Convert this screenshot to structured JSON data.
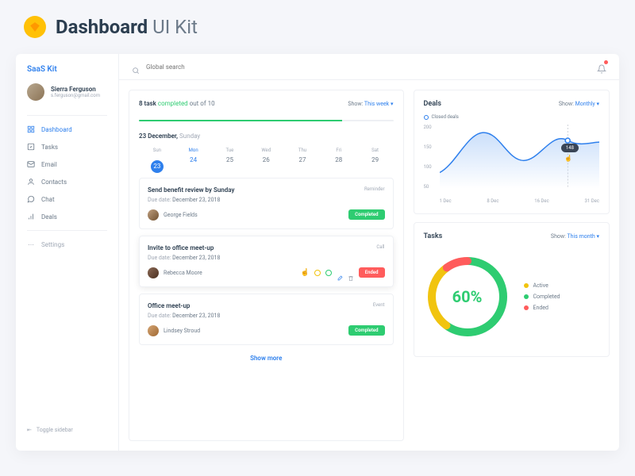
{
  "page": {
    "title_bold": "Dashboard",
    "title_light": " UI Kit"
  },
  "app": {
    "brand": "SaaS Kit",
    "user": {
      "name": "Sierra Ferguson",
      "email": "s.ferguson@gmail.com"
    },
    "nav": [
      {
        "label": "Dashboard",
        "icon": "grid-icon"
      },
      {
        "label": "Tasks",
        "icon": "checklist-icon"
      },
      {
        "label": "Email",
        "icon": "mail-icon"
      },
      {
        "label": "Contacts",
        "icon": "user-icon"
      },
      {
        "label": "Chat",
        "icon": "chat-icon"
      },
      {
        "label": "Deals",
        "icon": "bars-icon"
      }
    ],
    "settings_label": "Settings",
    "toggle_label": "Toggle sidebar",
    "search_placeholder": "Global search"
  },
  "tasks_card": {
    "summary": {
      "count": "8 task",
      "completed": "completed",
      "suffix": "out of 10"
    },
    "show_label": "Show:",
    "show_value": "This week",
    "date": {
      "bold": "23 December,",
      "day": "Sunday"
    },
    "week": [
      {
        "name": "Sun",
        "num": "23"
      },
      {
        "name": "Mon",
        "num": "24"
      },
      {
        "name": "Tue",
        "num": "25"
      },
      {
        "name": "Wed",
        "num": "26"
      },
      {
        "name": "Thu",
        "num": "27"
      },
      {
        "name": "Fri",
        "num": "28"
      },
      {
        "name": "Sat",
        "num": "29"
      }
    ],
    "items": [
      {
        "title": "Send benefit review by Sunday",
        "tag": "Reminder",
        "due_label": "Due date:",
        "due_value": "December 23, 2018",
        "assignee": "George Fields",
        "status": "Completed"
      },
      {
        "title": "Invite to office meet-up",
        "tag": "Call",
        "due_label": "Due date:",
        "due_value": "December 23, 2018",
        "assignee": "Rebecca Moore",
        "status": "Ended"
      },
      {
        "title": "Office meet-up",
        "tag": "Event",
        "due_label": "Due date:",
        "due_value": "December 23, 2018",
        "assignee": "Lindsey Stroud",
        "status": "Completed"
      }
    ],
    "show_more": "Show more"
  },
  "deals_card": {
    "title": "Deals",
    "show_label": "Show:",
    "show_value": "Monthly",
    "legend": "Closed deals",
    "tooltip": "148"
  },
  "tasks_donut": {
    "title": "Tasks",
    "show_label": "Show:",
    "show_value": "This month",
    "percent": "60%",
    "legend": [
      {
        "label": "Active",
        "color": "y"
      },
      {
        "label": "Completed",
        "color": "g"
      },
      {
        "label": "Ended",
        "color": "r"
      }
    ]
  },
  "chart_data": [
    {
      "type": "line",
      "title": "Deals — Closed deals",
      "x": [
        "1 Dec",
        "8 Dec",
        "16 Dec",
        "31 Dec"
      ],
      "series": [
        {
          "name": "Closed deals",
          "values": [
            60,
            180,
            100,
            148
          ]
        }
      ],
      "ylim": [
        0,
        200
      ],
      "yticks": [
        50,
        100,
        150,
        200
      ],
      "annotation": {
        "x": "≈24 Dec",
        "value": 148
      }
    },
    {
      "type": "pie",
      "title": "Tasks",
      "series": [
        {
          "name": "Completed",
          "value": 60
        },
        {
          "name": "Active",
          "value": 30
        },
        {
          "name": "Ended",
          "value": 10
        }
      ],
      "center_label": "60%"
    }
  ]
}
